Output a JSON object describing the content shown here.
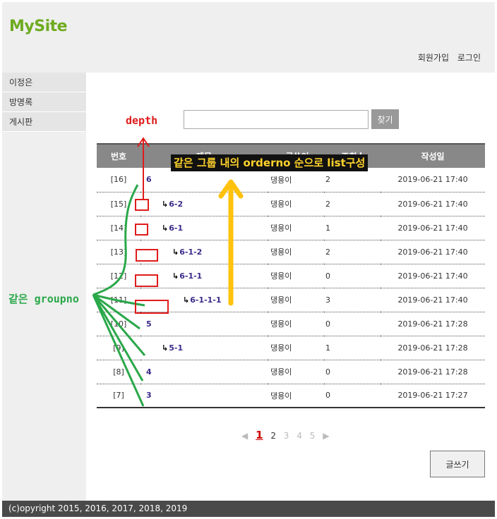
{
  "header": {
    "site_title": "MySite",
    "links": {
      "signup": "회원가입",
      "login": "로그인"
    }
  },
  "sidebar": {
    "items": [
      {
        "label": "이정은"
      },
      {
        "label": "방명록"
      },
      {
        "label": "게시판"
      }
    ]
  },
  "search": {
    "value": "",
    "button_label": "찾기"
  },
  "board": {
    "columns": [
      "번호",
      "제목",
      "글쓴이",
      "조회수",
      "작성일"
    ],
    "rows": [
      {
        "no": "[16]",
        "title": "6",
        "depth": 0,
        "writer": "댕용이",
        "hits": "2",
        "date": "2019-06-21 17:40"
      },
      {
        "no": "[15]",
        "title": "6-2",
        "depth": 1,
        "writer": "댕용이",
        "hits": "2",
        "date": "2019-06-21 17:40"
      },
      {
        "no": "[14]",
        "title": "6-1",
        "depth": 1,
        "writer": "댕용이",
        "hits": "1",
        "date": "2019-06-21 17:40"
      },
      {
        "no": "[13]",
        "title": "6-1-2",
        "depth": 2,
        "writer": "댕용이",
        "hits": "2",
        "date": "2019-06-21 17:40"
      },
      {
        "no": "[12]",
        "title": "6-1-1",
        "depth": 2,
        "writer": "댕용이",
        "hits": "0",
        "date": "2019-06-21 17:40"
      },
      {
        "no": "[11]",
        "title": "6-1-1-1",
        "depth": 3,
        "writer": "댕용이",
        "hits": "3",
        "date": "2019-06-21 17:40"
      },
      {
        "no": "[10]",
        "title": "5",
        "depth": 0,
        "writer": "댕용이",
        "hits": "0",
        "date": "2019-06-21 17:28"
      },
      {
        "no": "[9]",
        "title": "5-1",
        "depth": 1,
        "writer": "댕용이",
        "hits": "1",
        "date": "2019-06-21 17:28"
      },
      {
        "no": "[8]",
        "title": "4",
        "depth": 0,
        "writer": "댕용이",
        "hits": "0",
        "date": "2019-06-21 17:28"
      },
      {
        "no": "[7]",
        "title": "3",
        "depth": 0,
        "writer": "댕용이",
        "hits": "0",
        "date": "2019-06-21 17:27"
      }
    ]
  },
  "pager": {
    "prev_icon": "◀",
    "pages": [
      "1",
      "2",
      "3",
      "4",
      "5"
    ],
    "current_page": "1",
    "next_icon": "▶"
  },
  "write_button_label": "글쓰기",
  "footer": {
    "copyright": "(c)opyright 2015, 2016, 2017, 2018, 2019"
  },
  "annotations": {
    "depth_label": "depth",
    "groupno_label": "같은 groupno",
    "orderno_label": "같은 그룹 내의 orderno 순으로 list구성",
    "colors": {
      "red": "#e01b1b",
      "green": "#2aa84a",
      "yellow": "#ffc20e"
    }
  }
}
